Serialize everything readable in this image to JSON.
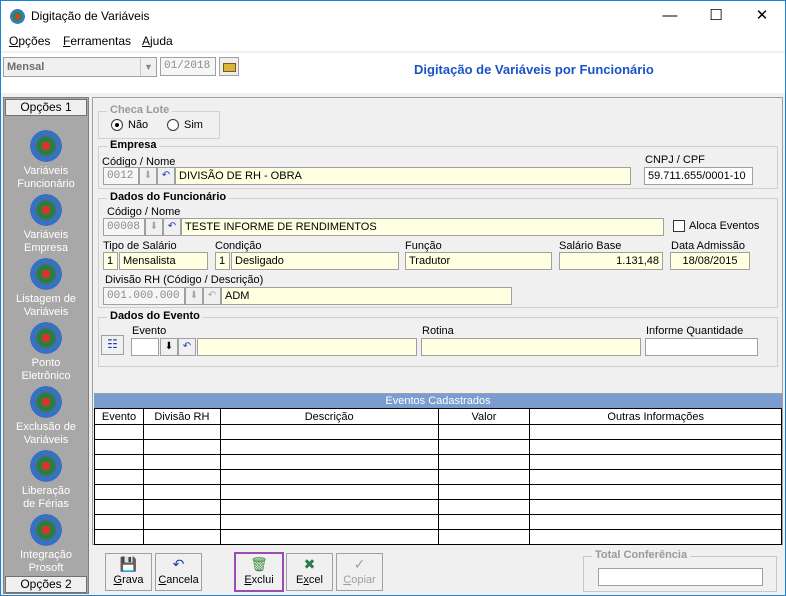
{
  "window": {
    "title": "Digitação de Variáveis"
  },
  "menu": [
    {
      "accel": "O",
      "rest": "pções"
    },
    {
      "accel": "F",
      "rest": "erramentas"
    },
    {
      "accel": "A",
      "rest": "juda"
    }
  ],
  "toolbar": {
    "period_type": "Mensal",
    "period": "01/2018",
    "title": "Digitação de Variáveis por Funcionário"
  },
  "sidebar": {
    "tab_top": "Opções 1",
    "tab_bottom": "Opções 2",
    "items": [
      {
        "line1": "Variáveis",
        "line2": "Funcionário",
        "icon": "globe-icon"
      },
      {
        "line1": "Variáveis",
        "line2": "Empresa",
        "icon": "globe-icon"
      },
      {
        "line1": "Listagem de",
        "line2": "Variáveis",
        "icon": "globe-icon"
      },
      {
        "line1": "Ponto",
        "line2": "Eletrônico",
        "icon": "globe-icon"
      },
      {
        "line1": "Exclusão de",
        "line2": "Variáveis",
        "icon": "globe-icon"
      },
      {
        "line1": "Liberação",
        "line2": "de Férias",
        "icon": "globe-icon"
      },
      {
        "line1": "Integração",
        "line2": "Prosoft",
        "icon": "globe-icon"
      }
    ]
  },
  "checa_lote": {
    "title": "Checa Lote",
    "opt_no": "Não",
    "opt_yes": "Sim",
    "selected": "Não"
  },
  "empresa": {
    "title": "Empresa",
    "code_label": "Código / Nome",
    "code": "0012",
    "name": "DIVISÃO DE RH - OBRA",
    "cnpj_label": "CNPJ / CPF",
    "cnpj": "59.711.655/0001-10"
  },
  "funcionario": {
    "title": "Dados do Funcionário",
    "code_label": "Código / Nome",
    "code": "00008",
    "name": "TESTE INFORME DE RENDIMENTOS",
    "aloca_label": "Aloca Eventos",
    "tipo_label": "Tipo de Salário",
    "tipo_code": "1",
    "tipo": "Mensalista",
    "cond_label": "Condição",
    "cond_code": "1",
    "cond": "Desligado",
    "funcao_label": "Função",
    "funcao": "Tradutor",
    "salario_label": "Salário Base",
    "salario": "1.131,48",
    "admissao_label": "Data Admissão",
    "admissao": "18/08/2015",
    "divisao_label": "Divisão RH (Código / Descrição)",
    "divisao_code": "001.000.000",
    "divisao": "ADM"
  },
  "evento": {
    "title": "Dados do Evento",
    "evento_label": "Evento",
    "rotina_label": "Rotina",
    "qtd_label": "Informe Quantidade"
  },
  "grid": {
    "caption": "Eventos Cadastrados",
    "columns": [
      "Evento",
      "Divisão RH",
      "Descrição",
      "Valor",
      "Outras Informações"
    ]
  },
  "buttons": {
    "grava": {
      "accel": "G",
      "rest": "rava"
    },
    "cancela": {
      "accel": "C",
      "rest": "ancela"
    },
    "exclui": {
      "accel": "E",
      "rest": "xclui"
    },
    "excel": {
      "pre": "E",
      "accel": "x",
      "rest": "cel"
    },
    "copiar": {
      "accel": "C",
      "rest": "opiar"
    }
  },
  "total": {
    "label": "Total Conferência"
  },
  "colors": {
    "accent": "#1c52c8",
    "grid_caption": "#7a9ccf",
    "field_bg": "#ffffe1",
    "selected_outline": "#9b4db0"
  }
}
